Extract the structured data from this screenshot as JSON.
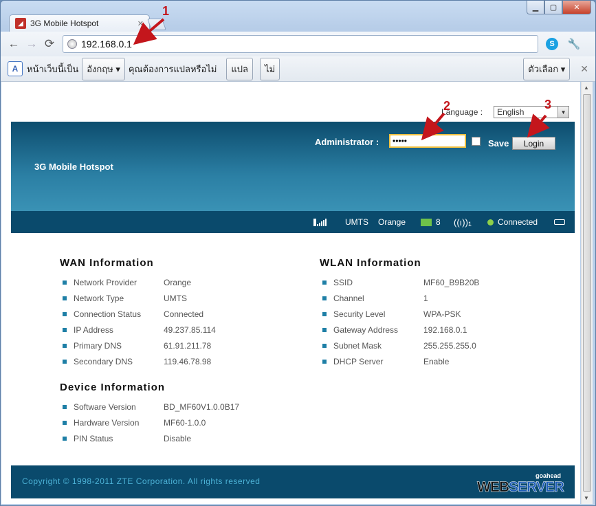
{
  "window": {
    "tab_title": "3G Mobile Hotspot",
    "tab_close": "✕",
    "controls": {
      "minimize": "▁",
      "maximize": "▢",
      "close": "✕"
    }
  },
  "toolbar": {
    "back": "←",
    "forward": "→",
    "reload": "⟳",
    "url": "192.168.0.1",
    "wrench": "🔧"
  },
  "translate_bar": {
    "prefix": "หน้าเว็บนี้เป็น",
    "language": "อังกฤษ ▾",
    "question": "คุณต้องการแปลหรือไม่",
    "translate_button": "แปล",
    "no_button": "ไม่",
    "options_button": "ตัวเลือก ▾",
    "close": "✕"
  },
  "page": {
    "language_label": "Language :",
    "language_value": "English",
    "banner_title": "3G Mobile Hotspot",
    "admin_label": "Administrator :",
    "password_value": "•••••",
    "save_label": "Save",
    "login_label": "Login",
    "status": {
      "network_mode": "UMTS",
      "provider": "Orange",
      "sms_count": "8",
      "wifi_clients": "1",
      "connection": "Connected"
    },
    "wan": {
      "title": "WAN Information",
      "rows": [
        {
          "label": "Network Provider",
          "value": "Orange"
        },
        {
          "label": "Network Type",
          "value": "UMTS"
        },
        {
          "label": "Connection Status",
          "value": "Connected"
        },
        {
          "label": "IP Address",
          "value": "49.237.85.114"
        },
        {
          "label": "Primary DNS",
          "value": "61.91.211.78"
        },
        {
          "label": "Secondary DNS",
          "value": "119.46.78.98"
        }
      ]
    },
    "wlan": {
      "title": "WLAN Information",
      "rows": [
        {
          "label": "SSID",
          "value": "MF60_B9B20B"
        },
        {
          "label": "Channel",
          "value": "1"
        },
        {
          "label": "Security Level",
          "value": "WPA-PSK"
        },
        {
          "label": "Gateway Address",
          "value": "192.168.0.1"
        },
        {
          "label": "Subnet Mask",
          "value": "255.255.255.0"
        },
        {
          "label": "DHCP Server",
          "value": "Enable"
        }
      ]
    },
    "device": {
      "title": "Device Information",
      "rows": [
        {
          "label": "Software Version",
          "value": "BD_MF60V1.0.0B17"
        },
        {
          "label": "Hardware Version",
          "value": "MF60-1.0.0"
        },
        {
          "label": "PIN Status",
          "value": "Disable"
        }
      ]
    },
    "footer": {
      "copyright": "Copyright © 1998-2011 ZTE Corporation. All rights reserved",
      "logo_small": "goahead",
      "logo_web": "WEB",
      "logo_server": "SERVER"
    }
  },
  "annotations": {
    "n1": "1",
    "n2": "2",
    "n3": "3",
    "color": "#c4161c"
  }
}
